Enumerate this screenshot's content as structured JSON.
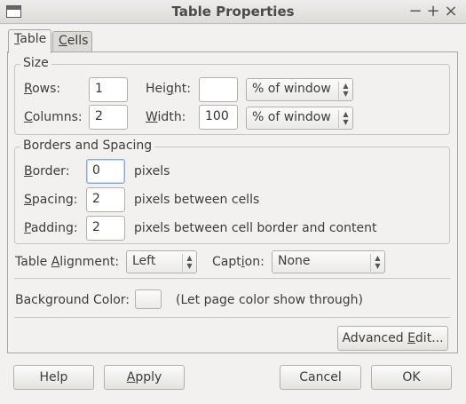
{
  "window": {
    "title": "Table Properties",
    "minimize_glyph": "−",
    "maximize_glyph": "+",
    "close_glyph": "×"
  },
  "tabs": [
    {
      "label": "Table",
      "mnemonic": "T",
      "rest": "able",
      "active": true
    },
    {
      "label": "Cells",
      "mnemonic": "C",
      "rest": "ells",
      "active": false
    }
  ],
  "size": {
    "legend": "Size",
    "rows": {
      "mn": "R",
      "rest": "ows:",
      "value": "1"
    },
    "columns": {
      "mn": "C",
      "rest": "olumns:",
      "value": "2"
    },
    "height": {
      "pre": "Hei",
      "mn": "g",
      "rest": "ht:",
      "value": "",
      "unit": "% of window"
    },
    "width": {
      "mn": "W",
      "rest": "idth:",
      "value": "100",
      "unit": "% of window"
    }
  },
  "borders": {
    "legend": "Borders and Spacing",
    "border": {
      "mn": "B",
      "rest": "order:",
      "value": "0",
      "suffix": "pixels"
    },
    "spacing": {
      "mn": "S",
      "rest": "pacing:",
      "value": "2",
      "suffix": "pixels between cells"
    },
    "padding": {
      "mn": "P",
      "rest": "adding:",
      "value": "2",
      "suffix": "pixels between cell border and content"
    }
  },
  "alignment": {
    "label_pre": "Table ",
    "label_mn": "A",
    "label_rest": "lignment:",
    "value": "Left",
    "caption_pre": "Capt",
    "caption_mn": "i",
    "caption_rest": "on:",
    "caption_value": "None"
  },
  "background": {
    "label": "Background Color:",
    "note": "(Let page color show through)"
  },
  "advanced": {
    "pre": "Advanced ",
    "mn": "E",
    "rest": "dit..."
  },
  "footer": {
    "help": "Help",
    "apply_mn": "A",
    "apply_rest": "pply",
    "cancel": "Cancel",
    "ok": "OK"
  },
  "arrows": {
    "up": "▲",
    "down": "▼"
  }
}
